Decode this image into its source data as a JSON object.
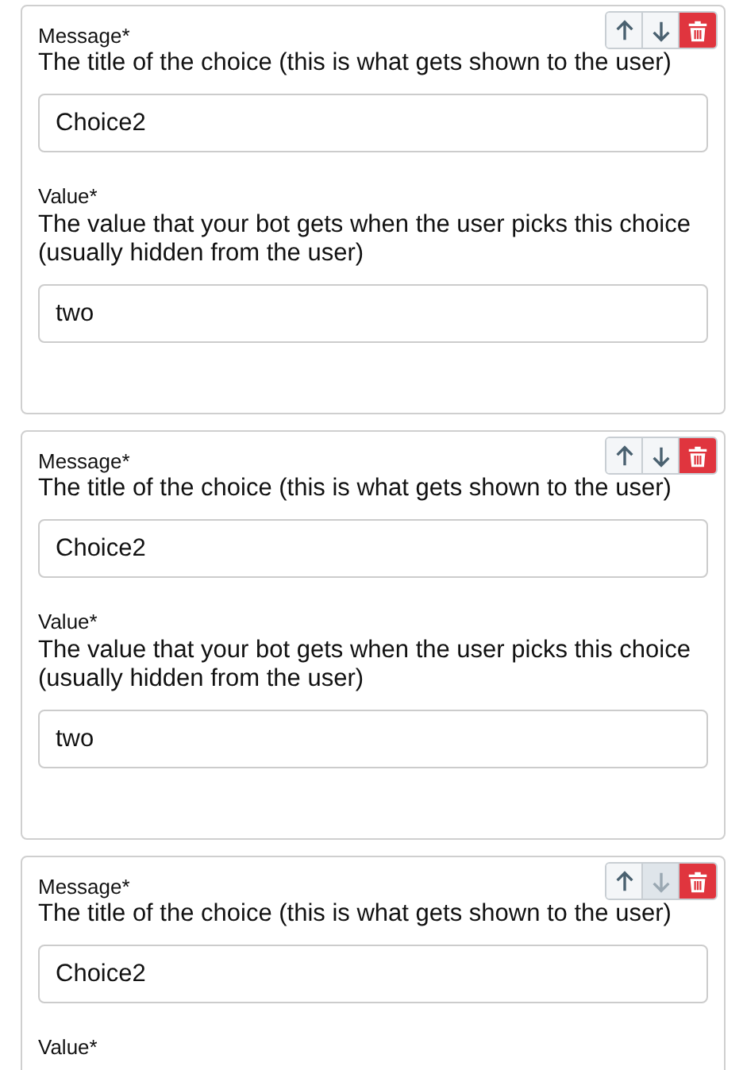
{
  "cards": [
    {
      "buttons": [
        {
          "kind": "up",
          "disabled": false
        },
        {
          "kind": "down",
          "disabled": false
        },
        {
          "kind": "delete"
        }
      ],
      "message": {
        "label": "Message*",
        "description": "The title of the choice (this is what gets shown to the user)",
        "value": "Choice2"
      },
      "value": {
        "label": "Value*",
        "description": "The value that your bot gets when the user picks this choice (usually hidden from the user)",
        "value": "two"
      }
    },
    {
      "buttons": [
        {
          "kind": "up",
          "disabled": false
        },
        {
          "kind": "down",
          "disabled": false
        },
        {
          "kind": "delete"
        }
      ],
      "message": {
        "label": "Message*",
        "description": "The title of the choice (this is what gets shown to the user)",
        "value": "Choice2"
      },
      "value": {
        "label": "Value*",
        "description": "The value that your bot gets when the user picks this choice (usually hidden from the user)",
        "value": "two"
      }
    },
    {
      "buttons": [
        {
          "kind": "up",
          "disabled": false
        },
        {
          "kind": "down",
          "disabled": true
        },
        {
          "kind": "delete"
        }
      ],
      "message": {
        "label": "Message*",
        "description": "The title of the choice (this is what gets shown to the user)",
        "value": "Choice2"
      },
      "value": {
        "label": "Value*"
      }
    }
  ]
}
